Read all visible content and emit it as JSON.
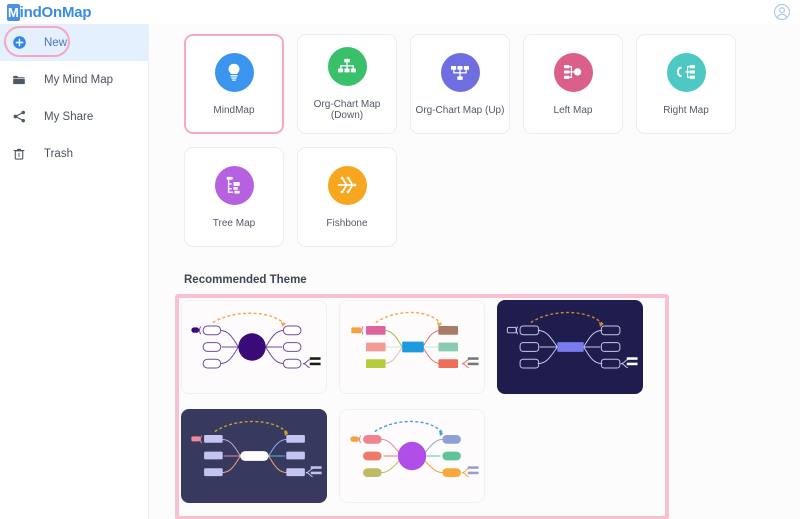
{
  "header": {
    "logo_badge": "M",
    "logo_text": "indOnMap",
    "avatar_icon": "user-circle-icon"
  },
  "sidebar": {
    "items": [
      {
        "label": "New",
        "icon": "plus-circle-icon",
        "active": true
      },
      {
        "label": "My Mind Map",
        "icon": "folder-icon",
        "active": false
      },
      {
        "label": "My Share",
        "icon": "share-icon",
        "active": false
      },
      {
        "label": "Trash",
        "icon": "trash-icon",
        "active": false
      }
    ]
  },
  "main": {
    "templates": [
      {
        "label": "MindMap",
        "icon": "mindmap-icon",
        "color": "#3b95ef",
        "selected": true
      },
      {
        "label": "Org-Chart Map (Down)",
        "icon": "org-chart-down-icon",
        "color": "#3ac06b",
        "selected": false
      },
      {
        "label": "Org-Chart Map (Up)",
        "icon": "org-chart-up-icon",
        "color": "#6f6ee0",
        "selected": false
      },
      {
        "label": "Left Map",
        "icon": "left-map-icon",
        "color": "#da5f8a",
        "selected": false
      },
      {
        "label": "Right Map",
        "icon": "right-map-icon",
        "color": "#4ec8c3",
        "selected": false
      },
      {
        "label": "Tree Map",
        "icon": "tree-map-icon",
        "color": "#b661e0",
        "selected": false
      },
      {
        "label": "Fishbone",
        "icon": "fishbone-icon",
        "color": "#f6a61f",
        "selected": false
      }
    ],
    "recommended_theme_title": "Recommended Theme",
    "themes": [
      {
        "name": "theme-purple-light",
        "style": "light",
        "center_color": "#3a0a78"
      },
      {
        "name": "theme-colorful-light",
        "style": "light",
        "center_color": "#1e9ae0"
      },
      {
        "name": "theme-navy-dark",
        "style": "dark",
        "center_color": "#7b7bf0"
      },
      {
        "name": "theme-slate-dark",
        "style": "dark2",
        "center_color": "#ffffff"
      },
      {
        "name": "theme-pastel-light",
        "style": "light",
        "center_color": "#b04fe8"
      }
    ],
    "theme_selection_highlight": "#f8c0d1"
  },
  "colors": {
    "accent_pink": "#f4a8bf",
    "brand_blue": "#3a8ae8",
    "sidebar_active_bg": "#e4f0fd"
  }
}
